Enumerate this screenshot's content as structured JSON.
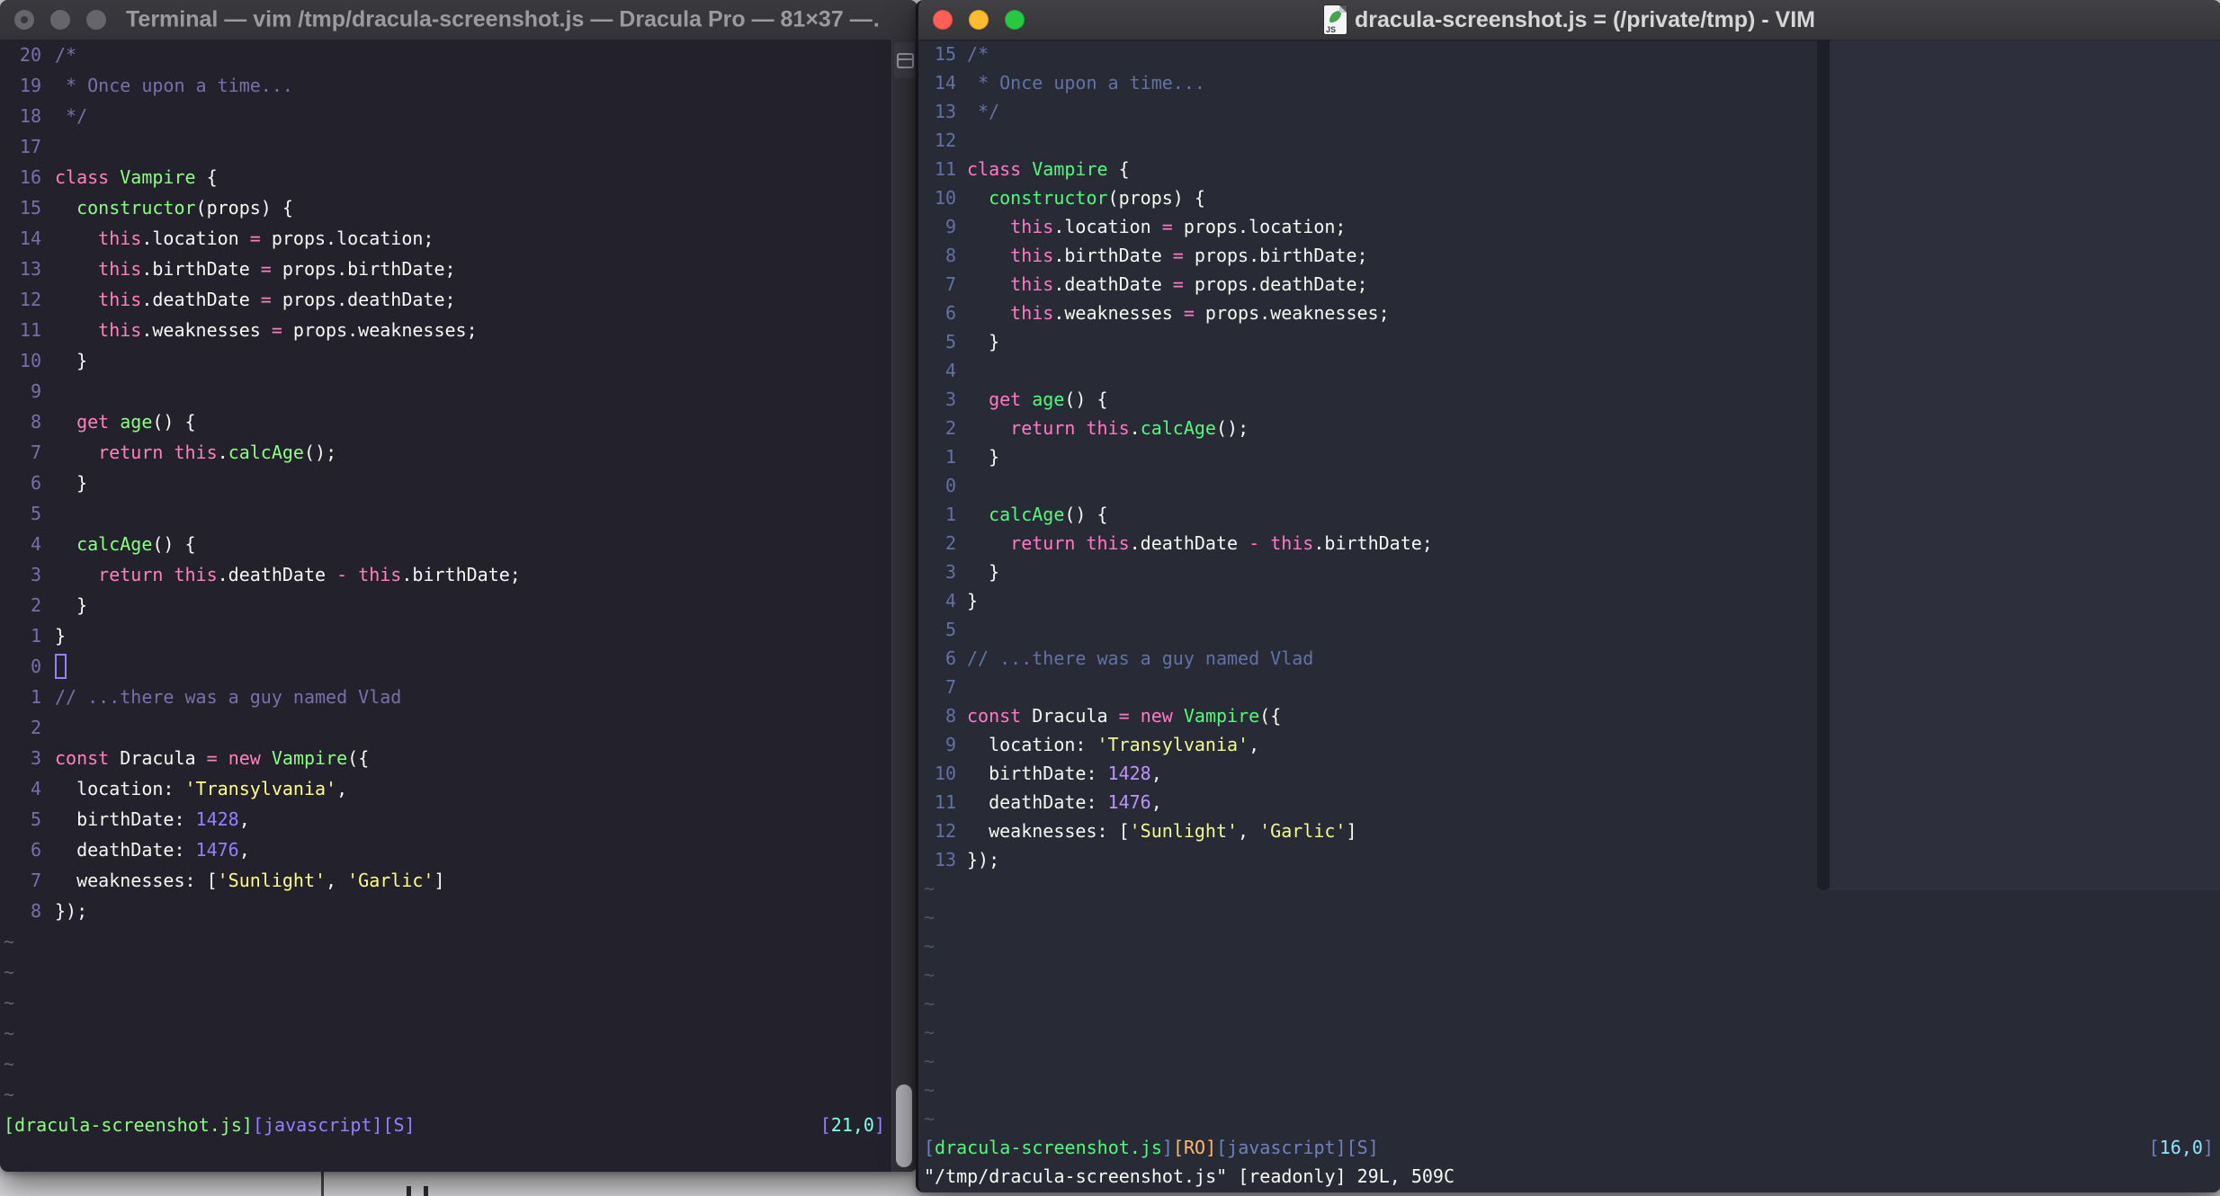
{
  "colors": {
    "pro_bg": "#22212C",
    "pro_fg": "#F8F8F2",
    "pro_comment": "#7970A9",
    "pro_pink": "#FF80BF",
    "pro_green": "#8AFF80",
    "pro_purple": "#9580FF",
    "pro_yellow": "#FFFF80",
    "pro_cyan": "#80FFEA",
    "pro_linenr": "#7970A9",
    "pro_tilde": "#625F78",
    "std_bg": "#282A36",
    "std_fg": "#F8F8F2",
    "std_comment": "#6272A4",
    "std_pink": "#FF79C6",
    "std_green": "#50FA7B",
    "std_purple": "#BD93F9",
    "std_yellow": "#F1FA8C",
    "std_cyan": "#8BE9FD",
    "std_orange": "#FFB86C",
    "std_linenr": "#6272A4",
    "std_tilde": "#4C5470",
    "std_slate": "#6D83BD"
  },
  "code_lines": [
    [
      [
        "c",
        "/*"
      ]
    ],
    [
      [
        "c",
        " * Once upon a time..."
      ]
    ],
    [
      [
        "c",
        " */"
      ]
    ],
    [],
    [
      [
        "k",
        "class"
      ],
      [
        "w",
        " "
      ],
      [
        "f",
        "Vampire"
      ],
      [
        "w",
        " {"
      ]
    ],
    [
      [
        "w",
        "  "
      ],
      [
        "f",
        "constructor"
      ],
      [
        "w",
        "(props) {"
      ]
    ],
    [
      [
        "w",
        "    "
      ],
      [
        "k",
        "this"
      ],
      [
        "w",
        ".location "
      ],
      [
        "k",
        "="
      ],
      [
        "w",
        " props.location;"
      ]
    ],
    [
      [
        "w",
        "    "
      ],
      [
        "k",
        "this"
      ],
      [
        "w",
        ".birthDate "
      ],
      [
        "k",
        "="
      ],
      [
        "w",
        " props.birthDate;"
      ]
    ],
    [
      [
        "w",
        "    "
      ],
      [
        "k",
        "this"
      ],
      [
        "w",
        ".deathDate "
      ],
      [
        "k",
        "="
      ],
      [
        "w",
        " props.deathDate;"
      ]
    ],
    [
      [
        "w",
        "    "
      ],
      [
        "k",
        "this"
      ],
      [
        "w",
        ".weaknesses "
      ],
      [
        "k",
        "="
      ],
      [
        "w",
        " props.weaknesses;"
      ]
    ],
    [
      [
        "w",
        "  }"
      ]
    ],
    [],
    [
      [
        "w",
        "  "
      ],
      [
        "k",
        "get"
      ],
      [
        "w",
        " "
      ],
      [
        "f",
        "age"
      ],
      [
        "w",
        "() {"
      ]
    ],
    [
      [
        "w",
        "    "
      ],
      [
        "k",
        "return"
      ],
      [
        "w",
        " "
      ],
      [
        "k",
        "this"
      ],
      [
        "w",
        "."
      ],
      [
        "f",
        "calcAge"
      ],
      [
        "w",
        "();"
      ]
    ],
    [
      [
        "w",
        "  }"
      ]
    ],
    [],
    [
      [
        "w",
        "  "
      ],
      [
        "f",
        "calcAge"
      ],
      [
        "w",
        "() {"
      ]
    ],
    [
      [
        "w",
        "    "
      ],
      [
        "k",
        "return"
      ],
      [
        "w",
        " "
      ],
      [
        "k",
        "this"
      ],
      [
        "w",
        ".deathDate "
      ],
      [
        "k",
        "-"
      ],
      [
        "w",
        " "
      ],
      [
        "k",
        "this"
      ],
      [
        "w",
        ".birthDate;"
      ]
    ],
    [
      [
        "w",
        "  }"
      ]
    ],
    [
      [
        "w",
        "}"
      ]
    ],
    [],
    [
      [
        "c",
        "// ...there was a guy named Vlad"
      ]
    ],
    [],
    [
      [
        "k",
        "const"
      ],
      [
        "w",
        " Dracula "
      ],
      [
        "k",
        "="
      ],
      [
        "w",
        " "
      ],
      [
        "k",
        "new"
      ],
      [
        "w",
        " "
      ],
      [
        "f",
        "Vampire"
      ],
      [
        "w",
        "({"
      ]
    ],
    [
      [
        "w",
        "  location: "
      ],
      [
        "s",
        "'Transylvania'"
      ],
      [
        "w",
        ","
      ]
    ],
    [
      [
        "w",
        "  birthDate: "
      ],
      [
        "p",
        "1428"
      ],
      [
        "w",
        ","
      ]
    ],
    [
      [
        "w",
        "  deathDate: "
      ],
      [
        "p",
        "1476"
      ],
      [
        "w",
        ","
      ]
    ],
    [
      [
        "w",
        "  weaknesses: ["
      ],
      [
        "s",
        "'Sunlight'"
      ],
      [
        "w",
        ", "
      ],
      [
        "s",
        "'Garlic'"
      ],
      [
        "w",
        "]"
      ]
    ],
    [
      [
        "w",
        "});"
      ]
    ]
  ],
  "left_window": {
    "title": "Terminal — vim /tmp/dracula-screenshot.js — Dracula Pro — 81×37 —…",
    "line_numbers": [
      "20",
      "19",
      "18",
      "17",
      "16",
      "15",
      "14",
      "13",
      "12",
      "11",
      "10",
      "9",
      "8",
      "7",
      "6",
      "5",
      "4",
      "3",
      "2",
      "1",
      "0",
      "1",
      "2",
      "3",
      "4",
      "5",
      "6",
      "7",
      "8"
    ],
    "cursor": "hollow",
    "cursor_line_index": 20,
    "tilde_rows": 6,
    "tilde_char": "~",
    "statusline": {
      "file": "[dracula-screenshot.js]",
      "flags": "[javascript][S]",
      "ruler_open": "[",
      "ruler": "21,0",
      "ruler_close": "]"
    },
    "cmdline": ""
  },
  "right_window": {
    "title": "dracula-screenshot.js = (/private/tmp) - VIM",
    "doc_icon_label": "JS",
    "line_numbers": [
      "15",
      "14",
      "13",
      "12",
      "11",
      "10",
      "9",
      "8",
      "7",
      "6",
      "5",
      "4",
      "3",
      "2",
      "1",
      "0",
      "1",
      "2",
      "3",
      "4",
      "5",
      "6",
      "7",
      "8",
      "9",
      "10",
      "11",
      "12",
      "13"
    ],
    "cursor": "none",
    "cursor_line_index": 15,
    "tilde_rows": 9,
    "tilde_char": "~",
    "statusline": {
      "file_open": "[",
      "file": "dracula-screenshot.js",
      "file_close": "]",
      "readonly_flag": "[RO]",
      "flags": "[javascript][S]",
      "ruler_open": "[",
      "ruler": "16,0",
      "ruler_close": "]"
    },
    "cmdline": "\"/tmp/dracula-screenshot.js\" [readonly] 29L, 509C"
  }
}
